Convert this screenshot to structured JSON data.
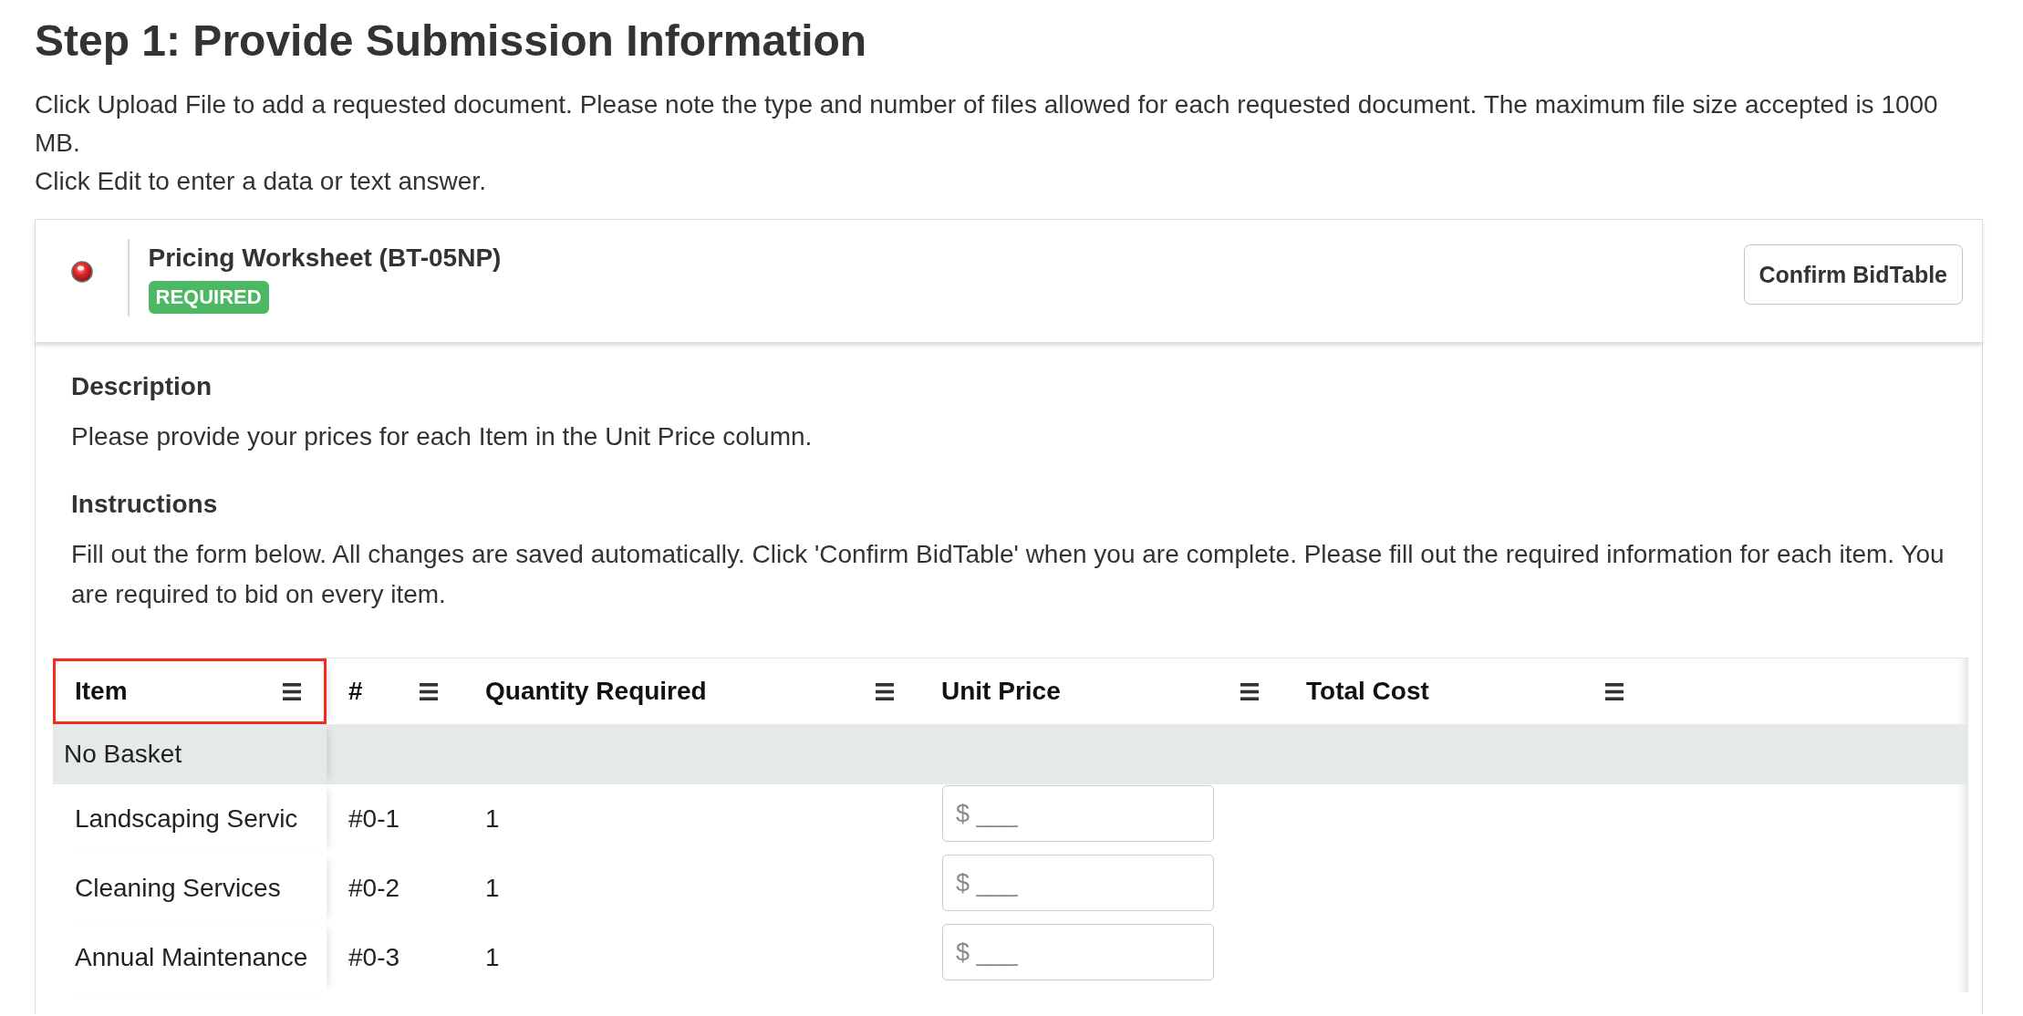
{
  "page": {
    "heading": "Step 1: Provide Submission Information",
    "intro": [
      "Click Upload File to add a requested document. Please note the type and number of files allowed for each requested document. The maximum file size accepted is 1000 MB.",
      "Click Edit to enter a data or text answer."
    ]
  },
  "document": {
    "complete": false,
    "title": "Pricing Worksheet (BT-05NP)",
    "badge": "REQUIRED",
    "confirm_button": "Confirm BidTable",
    "sections": [
      {
        "heading": "Description",
        "text": "Please provide your prices for each Item in the Unit Price column."
      },
      {
        "heading": "Instructions",
        "text": "Fill out the form below. All changes are saved automatically. Click 'Confirm BidTable' when you are complete. Please fill out the required information for each item. You are required to bid on every item."
      }
    ]
  },
  "table": {
    "columns": [
      {
        "label": "Item",
        "highlighted": true
      },
      {
        "label": "#",
        "highlighted": false
      },
      {
        "label": "Quantity Required",
        "highlighted": false
      },
      {
        "label": "Unit Price",
        "highlighted": false
      },
      {
        "label": "Total Cost",
        "highlighted": false
      }
    ],
    "groups": [
      {
        "label": "No Basket",
        "rows": [
          {
            "item": "Landscaping Servic",
            "number": "#0-1",
            "quantity": "1",
            "unit_price": {
              "placeholder": "$ ___"
            }
          },
          {
            "item": "Cleaning Services",
            "number": "#0-2",
            "quantity": "1",
            "unit_price": {
              "placeholder": "$ ___"
            }
          },
          {
            "item": "Annual Maintenance",
            "number": "#0-3",
            "quantity": "1",
            "unit_price": {
              "placeholder": "$ ___"
            }
          }
        ]
      }
    ]
  }
}
